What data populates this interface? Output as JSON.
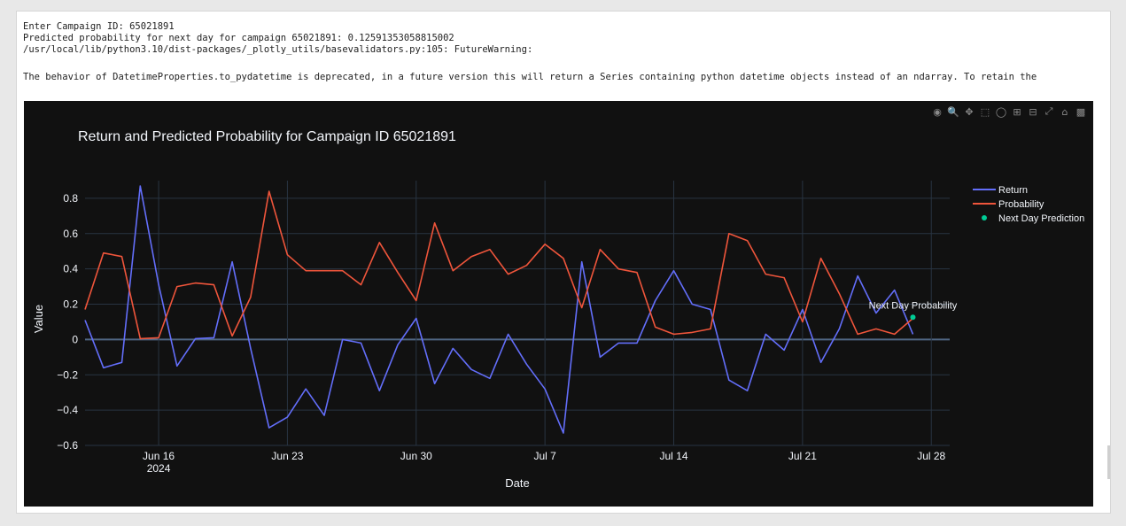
{
  "output": {
    "lines": [
      "Enter Campaign ID: 65021891",
      "Predicted probability for next day for campaign 65021891: 0.12591353058815002",
      "/usr/local/lib/python3.10/dist-packages/_plotly_utils/basevalidators.py:105: FutureWarning:",
      "The behavior of DatetimeProperties.to_pydatetime is deprecated, in a future version this will return a Series containing python datetime objects instead of an ndarray. To retain the"
    ]
  },
  "modebar": {
    "icons": [
      "camera-icon",
      "zoom-icon",
      "pan-icon",
      "box-select-icon",
      "lasso-icon",
      "zoom-in-icon",
      "zoom-out-icon",
      "autoscale-icon",
      "home-icon",
      "plotly-logo-icon"
    ]
  },
  "chart_data": {
    "type": "line",
    "title": "Return and Predicted Probability for Campaign ID 65021891",
    "xlabel": "Date",
    "ylabel": "Value",
    "ylim": [
      -0.6,
      0.9
    ],
    "xlim": [
      "2024-06-12",
      "2024-07-29"
    ],
    "x_ticks": [
      {
        "date": "2024-06-16",
        "label": "Jun 16",
        "sublabel": "2024"
      },
      {
        "date": "2024-06-23",
        "label": "Jun 23",
        "sublabel": ""
      },
      {
        "date": "2024-06-30",
        "label": "Jun 30",
        "sublabel": ""
      },
      {
        "date": "2024-07-07",
        "label": "Jul 7",
        "sublabel": ""
      },
      {
        "date": "2024-07-14",
        "label": "Jul 14",
        "sublabel": ""
      },
      {
        "date": "2024-07-21",
        "label": "Jul 21",
        "sublabel": ""
      },
      {
        "date": "2024-07-28",
        "label": "Jul 28",
        "sublabel": ""
      }
    ],
    "y_ticks": [
      {
        "value": -0.6,
        "label": "−0.6"
      },
      {
        "value": -0.4,
        "label": "−0.4"
      },
      {
        "value": -0.2,
        "label": "−0.2"
      },
      {
        "value": 0,
        "label": "0"
      },
      {
        "value": 0.2,
        "label": "0.2"
      },
      {
        "value": 0.4,
        "label": "0.4"
      },
      {
        "value": 0.6,
        "label": "0.6"
      },
      {
        "value": 0.8,
        "label": "0.8"
      }
    ],
    "grid": true,
    "legend_position": "top-right",
    "x": [
      "2024-06-12",
      "2024-06-13",
      "2024-06-14",
      "2024-06-15",
      "2024-06-16",
      "2024-06-17",
      "2024-06-18",
      "2024-06-19",
      "2024-06-20",
      "2024-06-21",
      "2024-06-22",
      "2024-06-23",
      "2024-06-24",
      "2024-06-25",
      "2024-06-26",
      "2024-06-27",
      "2024-06-28",
      "2024-06-29",
      "2024-06-30",
      "2024-07-01",
      "2024-07-02",
      "2024-07-03",
      "2024-07-04",
      "2024-07-05",
      "2024-07-06",
      "2024-07-07",
      "2024-07-08",
      "2024-07-09",
      "2024-07-10",
      "2024-07-11",
      "2024-07-12",
      "2024-07-13",
      "2024-07-14",
      "2024-07-15",
      "2024-07-16",
      "2024-07-17",
      "2024-07-18",
      "2024-07-19",
      "2024-07-20",
      "2024-07-21",
      "2024-07-22",
      "2024-07-23",
      "2024-07-24",
      "2024-07-25",
      "2024-07-26",
      "2024-07-27"
    ],
    "series": [
      {
        "name": "Return",
        "color": "#636efa",
        "mode": "line",
        "values": [
          0.11,
          -0.16,
          -0.13,
          0.87,
          0.31,
          -0.15,
          0.005,
          0.01,
          0.44,
          -0.05,
          -0.5,
          -0.44,
          -0.28,
          -0.43,
          0.0,
          -0.02,
          -0.29,
          -0.03,
          0.12,
          -0.25,
          -0.05,
          -0.17,
          -0.22,
          0.03,
          -0.14,
          -0.28,
          -0.53,
          0.44,
          -0.1,
          -0.02,
          -0.02,
          0.22,
          0.39,
          0.2,
          0.17,
          -0.23,
          -0.29,
          0.03,
          -0.06,
          0.17,
          -0.13,
          0.06,
          0.36,
          0.15,
          0.28,
          0.03
        ]
      },
      {
        "name": "Probability",
        "color": "#ef553b",
        "mode": "line",
        "values": [
          0.17,
          0.49,
          0.47,
          0.005,
          0.01,
          0.3,
          0.32,
          0.31,
          0.02,
          0.24,
          0.84,
          0.48,
          0.39,
          0.39,
          0.39,
          0.31,
          0.55,
          0.38,
          0.22,
          0.66,
          0.39,
          0.47,
          0.51,
          0.37,
          0.42,
          0.54,
          0.46,
          0.18,
          0.51,
          0.4,
          0.38,
          0.07,
          0.03,
          0.04,
          0.06,
          0.6,
          0.56,
          0.37,
          0.35,
          0.1,
          0.46,
          0.26,
          0.03,
          0.06,
          0.03,
          0.12
        ]
      },
      {
        "name": "Next Day Prediction",
        "color": "#00cc96",
        "mode": "marker",
        "points": [
          {
            "x": "2024-07-27",
            "y": 0.12591353058815002
          }
        ],
        "annotation": "Next Day Probability"
      }
    ]
  }
}
